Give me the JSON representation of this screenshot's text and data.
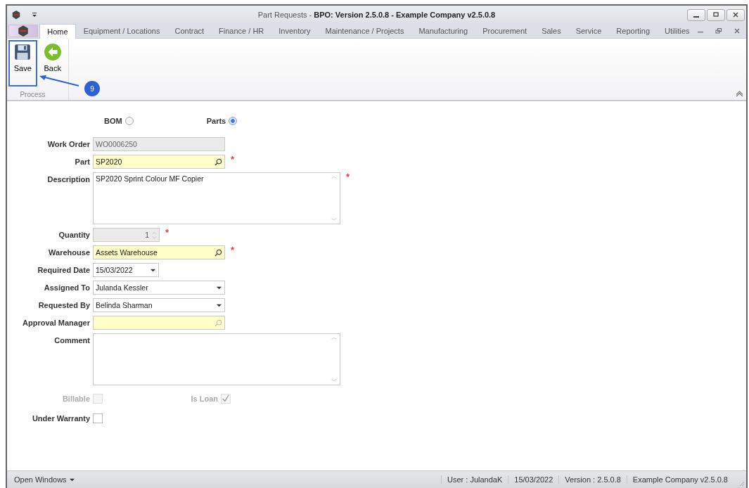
{
  "window": {
    "title": "Part Requests - **BPO: Version 2.5.0.8 - Example Company v2.5.0.8**"
  },
  "tabs": [
    {
      "label": "Home",
      "selected": true
    },
    {
      "label": "Equipment / Locations",
      "selected": false
    },
    {
      "label": "Contract",
      "selected": false
    },
    {
      "label": "Finance / HR",
      "selected": false
    },
    {
      "label": "Inventory",
      "selected": false
    },
    {
      "label": "Maintenance / Projects",
      "selected": false
    },
    {
      "label": "Manufacturing",
      "selected": false
    },
    {
      "label": "Procurement",
      "selected": false
    },
    {
      "label": "Sales",
      "selected": false
    },
    {
      "label": "Service",
      "selected": false
    },
    {
      "label": "Reporting",
      "selected": false
    },
    {
      "label": "Utilities",
      "selected": false
    }
  ],
  "ribbon": {
    "group": "Process",
    "buttons": [
      {
        "label": "Save",
        "kind": "save",
        "highlighted": true
      },
      {
        "label": "Back",
        "kind": "back",
        "highlighted": false
      }
    ]
  },
  "annotation": {
    "step": "9"
  },
  "source_options": [
    {
      "label": "BOM",
      "selected": false
    },
    {
      "label": "Parts",
      "selected": true
    }
  ],
  "fields": [
    {
      "label": "Work Order",
      "kind": "text",
      "value": "WO0006250",
      "disabled": true,
      "highlight": false
    },
    {
      "label": "Part",
      "kind": "lookup",
      "value": "SP2020",
      "disabled": false,
      "highlight": true,
      "required_mark": "*"
    },
    {
      "label": "Description",
      "kind": "memo",
      "value": "SP2020 Sprint Colour MF Copier",
      "disabled": false,
      "highlight": false,
      "required_mark": "*"
    },
    {
      "label": "Quantity",
      "kind": "spin",
      "value": "1",
      "disabled": true,
      "highlight": false,
      "required_mark": "*"
    },
    {
      "label": "Warehouse",
      "kind": "lookup",
      "value": "Assets Warehouse",
      "disabled": false,
      "highlight": true,
      "required_mark": "*"
    },
    {
      "label": "Required Date",
      "kind": "date",
      "value": "15/03/2022",
      "disabled": false,
      "highlight": false
    },
    {
      "label": "Assigned To",
      "kind": "combo",
      "value": "Julanda Kessler",
      "disabled": false,
      "highlight": false
    },
    {
      "label": "Requested By",
      "kind": "combo",
      "value": "Belinda Sharman",
      "disabled": false,
      "highlight": false
    },
    {
      "label": "Approval Manager",
      "kind": "lookup",
      "disabled": false,
      "highlight": true
    },
    {
      "label": "Comment",
      "kind": "memo",
      "disabled": false,
      "highlight": false
    }
  ],
  "flags": [
    {
      "label": "Billable",
      "checked": false,
      "disabled": true
    },
    {
      "label": "Is Loan",
      "checked": true,
      "disabled": true
    }
  ],
  "warranty": {
    "label": "Under Warranty",
    "checked": false,
    "disabled": false
  },
  "status_bar": {
    "open_windows": "Open Windows",
    "items": [
      "User : JulandaK",
      "15/03/2022",
      "Version : 2.5.0.8",
      "Example Company v2.5.0.8"
    ]
  }
}
